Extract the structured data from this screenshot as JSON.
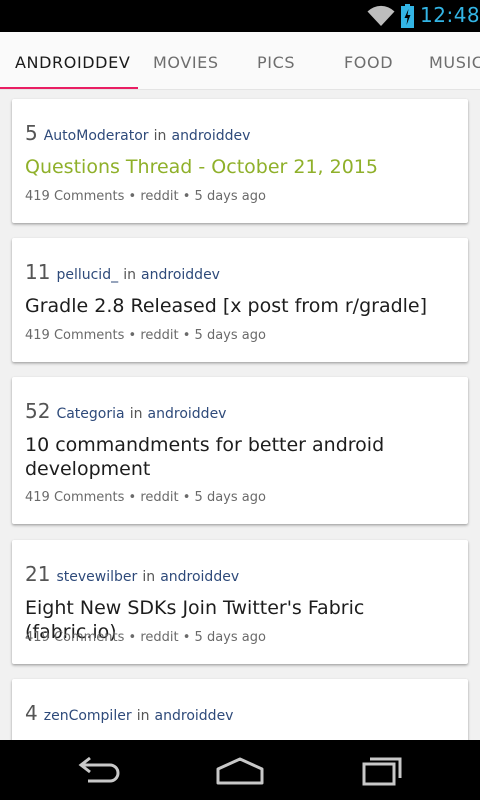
{
  "status_bar": {
    "time": "12:48",
    "icons": [
      "wifi-icon",
      "battery-charging-icon"
    ],
    "accent": "#33b5e5"
  },
  "tabs": [
    {
      "label": "ANDROIDDEV",
      "active": true
    },
    {
      "label": "MOVIES",
      "active": false
    },
    {
      "label": "PICS",
      "active": false
    },
    {
      "label": "FOOD",
      "active": false
    },
    {
      "label": "MUSIC",
      "active": false
    }
  ],
  "indicator_color": "#e91e63",
  "posts": [
    {
      "score": "5",
      "author": "AutoModerator",
      "in_text": "in",
      "subreddit": "androiddev",
      "title": "Questions Thread - October 21, 2015",
      "sticky": true,
      "footer": "419 Comments • reddit • 5 days ago"
    },
    {
      "score": "11",
      "author": "pellucid_",
      "in_text": "in",
      "subreddit": "androiddev",
      "title": "Gradle 2.8 Released [x post from r/gradle]",
      "sticky": false,
      "footer": "419 Comments • reddit • 5 days ago"
    },
    {
      "score": "52",
      "author": "Categoria",
      "in_text": "in",
      "subreddit": "androiddev",
      "title": "10 commandments for better android development",
      "sticky": false,
      "footer": "419 Comments • reddit • 5 days ago"
    },
    {
      "score": "21",
      "author": "stevewilber",
      "in_text": "in",
      "subreddit": "androiddev",
      "title": "Eight New SDKs Join Twitter's Fabric (fabric.io)",
      "sticky": false,
      "footer": "419 Comments • reddit • 5 days ago"
    },
    {
      "score": "4",
      "author": "zenCompiler",
      "in_text": "in",
      "subreddit": "androiddev",
      "title": "",
      "sticky": false,
      "footer": ""
    }
  ],
  "colors": {
    "sticky_title": "#8fb02a",
    "author": "#2e4a7a"
  },
  "nav_bar": {
    "buttons": [
      "back-icon",
      "home-icon",
      "recent-apps-icon"
    ]
  }
}
